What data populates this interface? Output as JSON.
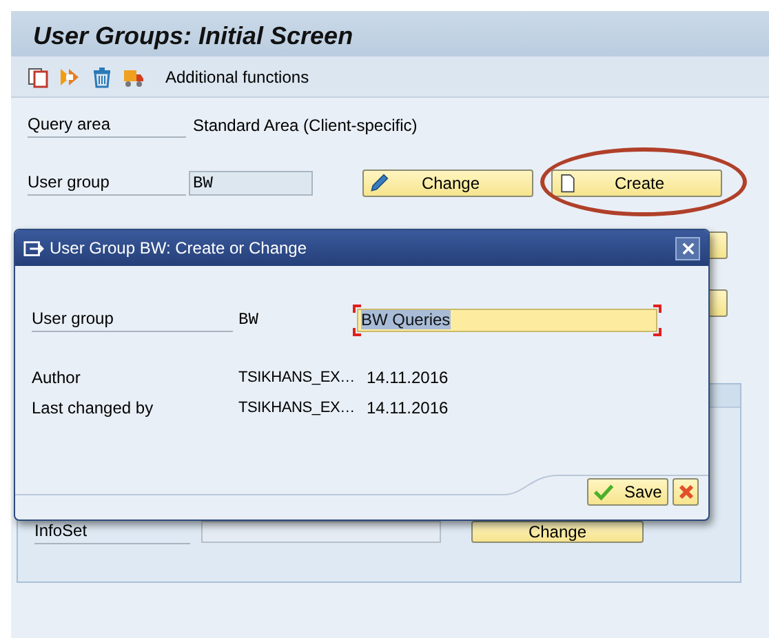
{
  "screen": {
    "title": "User Groups: Initial Screen"
  },
  "toolbar": {
    "label": "Additional functions"
  },
  "fields": [
    {
      "label": "Query area",
      "value": "Standard Area (Client-specific)",
      "kind": "text"
    },
    {
      "label": "User group",
      "value": "BW",
      "kind": "input"
    }
  ],
  "actions": [
    {
      "label": "Change",
      "kind": "edit",
      "highlighted": false
    },
    {
      "label": "Create",
      "kind": "new",
      "highlighted": true
    }
  ],
  "panel": {
    "rows": [
      {
        "label": "InfoSet",
        "button": "Change"
      }
    ]
  },
  "dialog": {
    "title": "User Group BW: Create or Change",
    "user_group": {
      "label": "User group",
      "code": "BW",
      "description": "BW Queries"
    },
    "info": [
      {
        "label": "Author",
        "user": "TSIKHANS_EX…",
        "date": "14.11.2016"
      },
      {
        "label": "Last changed by",
        "user": "TSIKHANS_EX…",
        "date": "14.11.2016"
      }
    ],
    "buttons": [
      {
        "label": "Save",
        "kind": "save"
      },
      {
        "kind": "cancel"
      }
    ]
  }
}
